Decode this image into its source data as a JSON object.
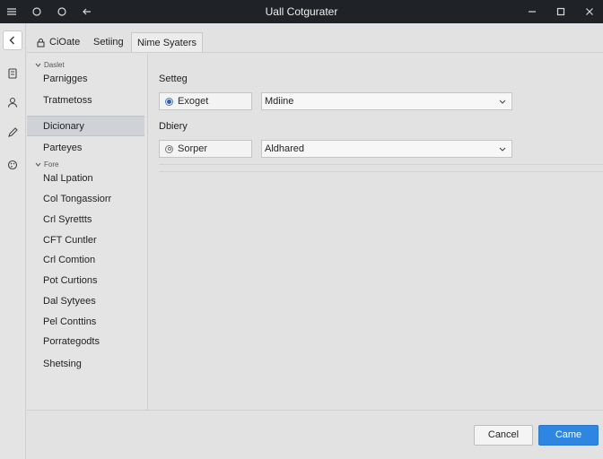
{
  "window": {
    "title": "Uall Cotgurater",
    "controls": {
      "minimize_icon": "minimize-icon",
      "maximize_icon": "maximize-icon",
      "close_icon": "close-icon"
    },
    "left_icons": [
      "menu-icon",
      "circle-icon",
      "circle-icon",
      "back-arrow-icon"
    ]
  },
  "rail": {
    "items": [
      "back-chevron-icon",
      "document-icon",
      "user-icon",
      "pencil-icon",
      "palette-icon"
    ]
  },
  "tabs": [
    {
      "label": "CiOate",
      "icon": "lock-icon"
    },
    {
      "label": "Setiing"
    },
    {
      "label": "Nime Syaters",
      "active": true
    }
  ],
  "sidebar": {
    "groups": [
      {
        "header": "Daslet",
        "items": [
          {
            "label": "Parnigges"
          },
          {
            "label": "Tratmetoss"
          },
          {
            "label": "Dicionary",
            "selected": true
          },
          {
            "label": "Parteyes"
          }
        ]
      },
      {
        "header": "Fore",
        "items": [
          {
            "label": "Nal Lpation"
          },
          {
            "label": "Col Tongassiorr"
          },
          {
            "label": "Crl Syrettts"
          },
          {
            "label": "CFT Cuntler"
          },
          {
            "label": "Crl Comtion"
          },
          {
            "label": "Pot Curtions"
          },
          {
            "label": "Dal Sytyees"
          },
          {
            "label": "Pel Conttins"
          },
          {
            "label": "Porrategodts"
          },
          {
            "label": "Shetsing"
          }
        ]
      }
    ]
  },
  "main": {
    "section1": {
      "label": "Setteg",
      "radio_label": "Exoget",
      "radio_checked": true,
      "select_value": "Mdiine"
    },
    "section2": {
      "label": "Dbiery",
      "radio_label": "Sorper",
      "radio_checked": false,
      "select_value": "Aldhared"
    }
  },
  "footer": {
    "cancel_label": "Cancel",
    "primary_label": "Came"
  },
  "colors": {
    "titlebar": "#1f2328",
    "accent": "#2f86e0",
    "selected_row": "#cfd3d8"
  }
}
